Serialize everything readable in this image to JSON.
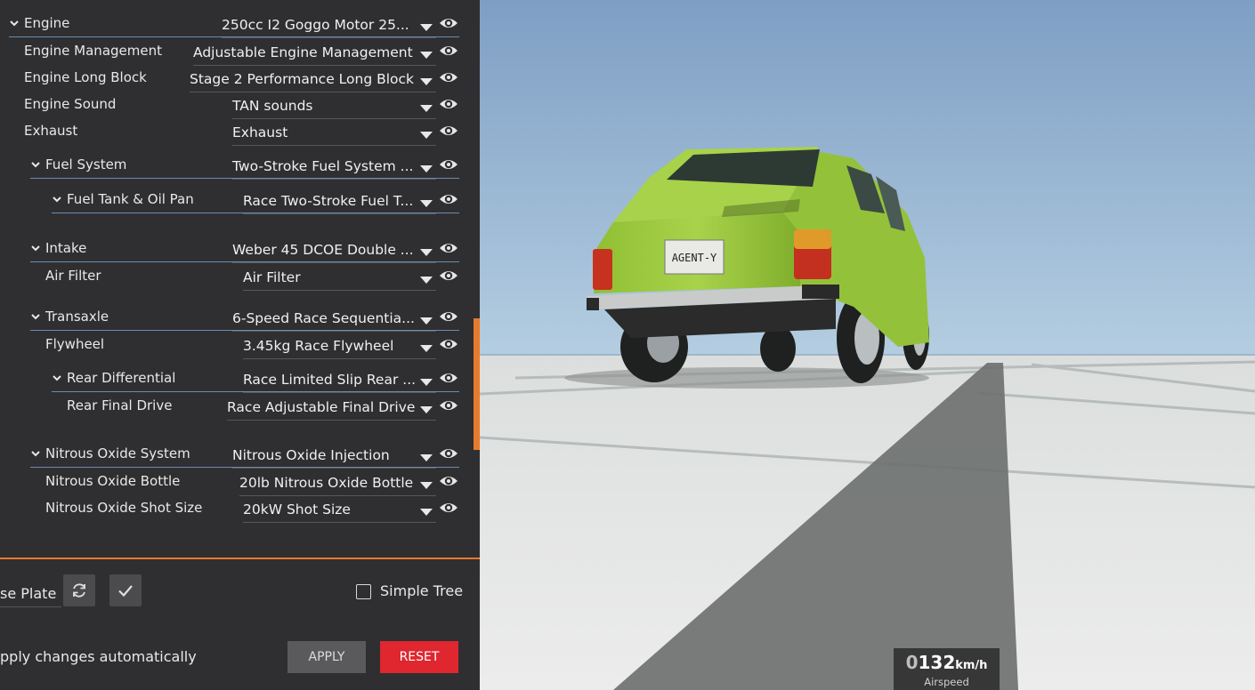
{
  "parts": [
    {
      "label": "Engine",
      "value": "250cc I2 Goggo Motor 25...",
      "expandable": true,
      "indent": 0
    },
    {
      "label": "Engine Management",
      "value": "Adjustable Engine Management",
      "expandable": false,
      "indent": 1
    },
    {
      "label": "Engine Long Block",
      "value": "Stage 2 Performance Long Block",
      "expandable": false,
      "indent": 1
    },
    {
      "label": "Engine Sound",
      "value": "TAN sounds",
      "expandable": false,
      "indent": 1
    },
    {
      "label": "Exhaust",
      "value": "Exhaust",
      "expandable": false,
      "indent": 1
    },
    {
      "label": "Fuel System",
      "value": "Two-Stroke Fuel System ...",
      "expandable": true,
      "indent": 1
    },
    {
      "label": "Fuel Tank & Oil Pan",
      "value": "Race Two-Stroke Fuel T...",
      "expandable": true,
      "indent": 2
    },
    {
      "label": "Intake",
      "value": "Weber 45 DCOE Double ...",
      "expandable": true,
      "indent": 1
    },
    {
      "label": "Air Filter",
      "value": "Air Filter",
      "expandable": false,
      "indent": 2
    },
    {
      "label": "Transaxle",
      "value": "6-Speed Race Sequentia...",
      "expandable": true,
      "indent": 1
    },
    {
      "label": "Flywheel",
      "value": "3.45kg Race Flywheel",
      "expandable": false,
      "indent": 2
    },
    {
      "label": "Rear Differential",
      "value": "Race Limited Slip Rear ...",
      "expandable": true,
      "indent": 2
    },
    {
      "label": "Rear Final Drive",
      "value": "Race Adjustable Final Drive",
      "expandable": false,
      "indent": 3
    },
    {
      "label": "Nitrous Oxide System",
      "value": "Nitrous Oxide Injection",
      "expandable": true,
      "indent": 1
    },
    {
      "label": "Nitrous Oxide Bottle",
      "value": "20lb Nitrous Oxide Bottle",
      "expandable": false,
      "indent": 2
    },
    {
      "label": "Nitrous Oxide Shot Size",
      "value": "20kW Shot Size",
      "expandable": false,
      "indent": 2
    }
  ],
  "bottom": {
    "license_plate_label": "se Plate",
    "simple_tree_label": "Simple Tree",
    "simple_tree_checked": false,
    "auto_apply_label": "pply changes automatically",
    "apply_label": "APPLY",
    "reset_label": "RESET"
  },
  "vehicle": {
    "plate_text": "AGENT-Y",
    "body_color": "#a6cf45"
  },
  "hud": {
    "speed_leading": "0",
    "speed_value": "132",
    "speed_unit": "km/h",
    "speed_caption": "Airspeed"
  },
  "colors": {
    "accent": "#e67b2b",
    "reset": "#e0262f",
    "panel_bg": "#2f2f31"
  }
}
